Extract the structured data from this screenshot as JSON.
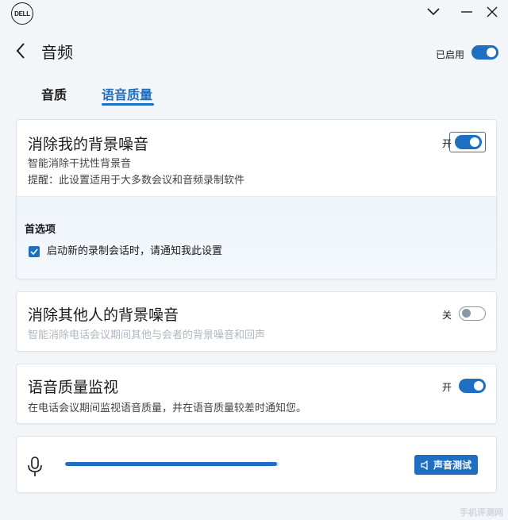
{
  "app": {
    "logo_text": "DELL"
  },
  "header": {
    "title": "音频",
    "enabled_label": "已启用",
    "enabled": true
  },
  "tabs": [
    {
      "label": "音质",
      "active": false
    },
    {
      "label": "语音质量",
      "active": true
    }
  ],
  "noise_mine": {
    "title": "消除我的背景噪音",
    "state_label": "开",
    "enabled": true,
    "desc": "智能消除干扰性背景音",
    "reminder": "提醒：此设置适用于大多数会议和音频录制软件",
    "pref_title": "首选项",
    "pref_option": "启动新的录制会话时，请通知我此设置",
    "pref_checked": true
  },
  "noise_others": {
    "title": "消除其他人的背景噪音",
    "state_label": "关",
    "enabled": false,
    "desc": "智能消除电话会议期间其他与会者的背景噪音和回声"
  },
  "quality_monitor": {
    "title": "语音质量监视",
    "state_label": "开",
    "enabled": true,
    "desc": "在电话会议期间监视语音质量，并在语音质量较差时通知您。"
  },
  "sound_test": {
    "button_label": "声音测试",
    "level_fraction": 0.99
  },
  "watermark": "手机评测网",
  "colors": {
    "accent": "#1e6fc2",
    "background": "#f3f6f9",
    "card": "#ffffff"
  }
}
